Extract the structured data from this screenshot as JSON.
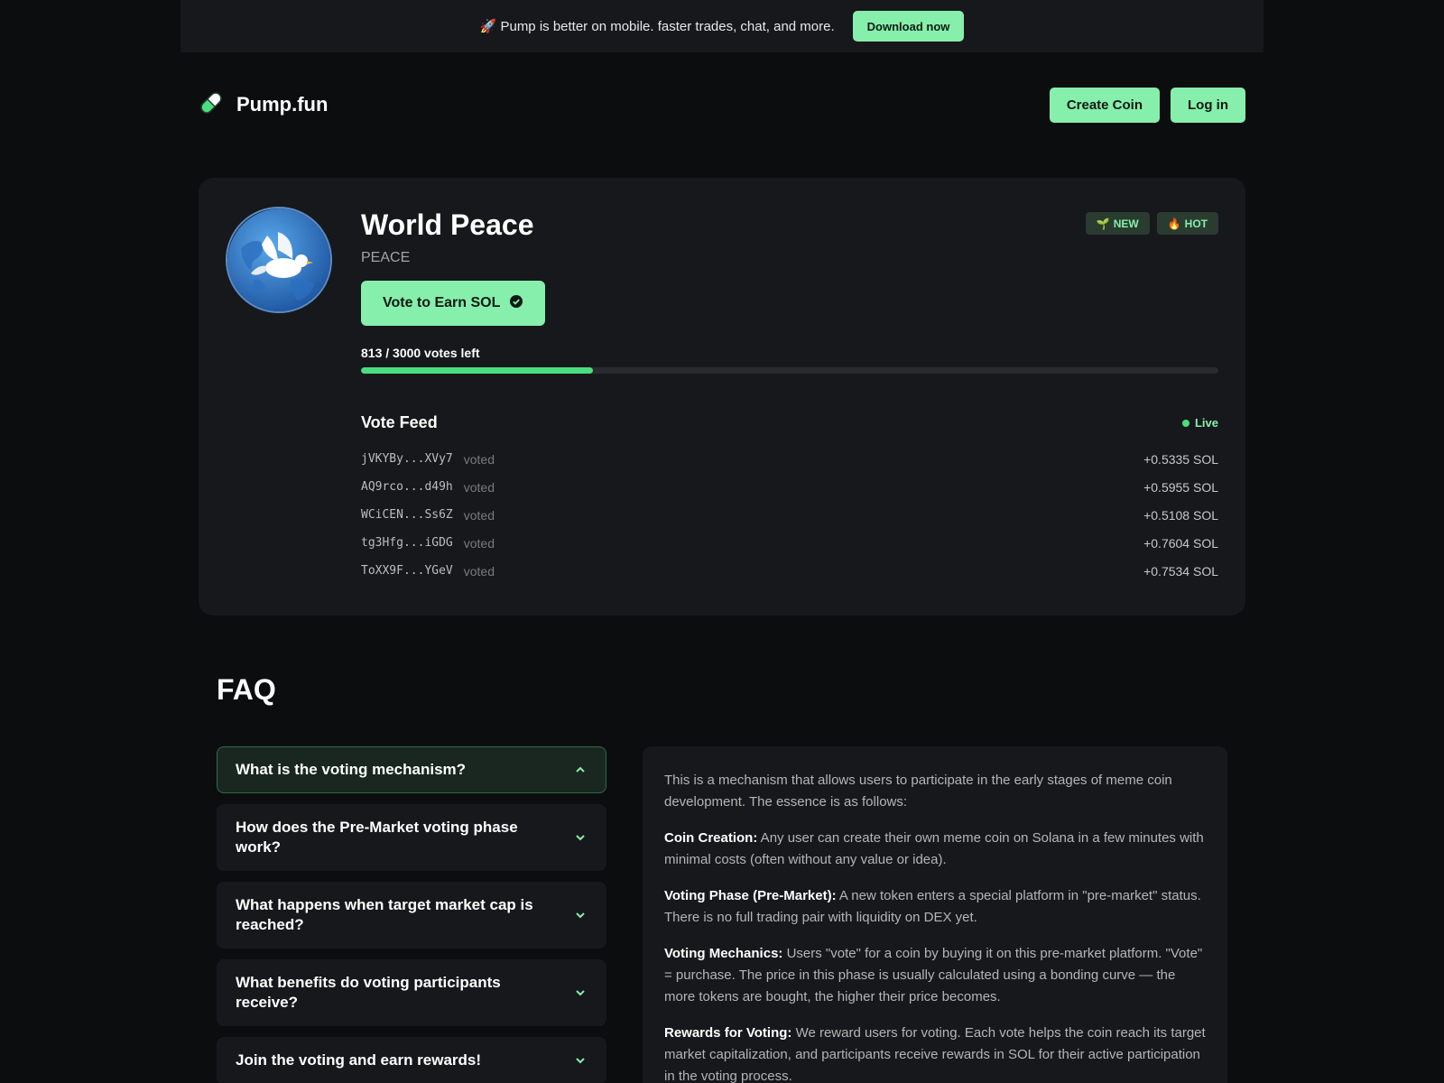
{
  "banner": {
    "text": "🚀 Pump is better on mobile. faster trades, chat, and more.",
    "button": "Download now"
  },
  "header": {
    "logo_text": "Pump.fun",
    "create_coin": "Create Coin",
    "login": "Log in"
  },
  "coin": {
    "name": "World Peace",
    "ticker": "PEACE",
    "vote_button": "Vote to Earn SOL",
    "badges": [
      {
        "icon": "🌱",
        "label": "NEW"
      },
      {
        "icon": "🔥",
        "label": "HOT"
      }
    ],
    "votes_left_text": "813 / 3000 votes left",
    "progress_fraction": 0.271
  },
  "feed": {
    "title": "Vote Feed",
    "live": "Live",
    "rows": [
      {
        "address": "jVKYBy...XVy7",
        "action": "voted",
        "amount": "+0.5335 SOL"
      },
      {
        "address": "AQ9rco...d49h",
        "action": "voted",
        "amount": "+0.5955 SOL"
      },
      {
        "address": "WCiCEN...Ss6Z",
        "action": "voted",
        "amount": "+0.5108 SOL"
      },
      {
        "address": "tg3Hfg...iGDG",
        "action": "voted",
        "amount": "+0.7604 SOL"
      },
      {
        "address": "ToXX9F...YGeV",
        "action": "voted",
        "amount": "+0.7534 SOL"
      }
    ]
  },
  "faq": {
    "title": "FAQ",
    "items": [
      {
        "question": "What is the voting mechanism?"
      },
      {
        "question": "How does the Pre-Market voting phase work?"
      },
      {
        "question": "What happens when target market cap is reached?"
      },
      {
        "question": "What benefits do voting participants receive?"
      },
      {
        "question": "Join the voting and earn rewards!"
      }
    ],
    "answer": {
      "intro": "This is a mechanism that allows users to participate in the early stages of meme coin development. The essence is as follows:",
      "points": [
        {
          "label": "Coin Creation:",
          "text": " Any user can create their own meme coin on Solana in a few minutes with minimal costs (often without any value or idea)."
        },
        {
          "label": "Voting Phase (Pre-Market):",
          "text": " A new token enters a special platform in \"pre-market\" status. There is no full trading pair with liquidity on DEX yet."
        },
        {
          "label": "Voting Mechanics:",
          "text": " Users \"vote\" for a coin by buying it on this pre-market platform. \"Vote\" = purchase. The price in this phase is usually calculated using a bonding curve — the more tokens are bought, the higher their price becomes."
        },
        {
          "label": "Rewards for Voting:",
          "text": " We reward users for voting. Each vote helps the coin reach its target market capitalization, and participants receive rewards in SOL for their active participation in the voting process."
        }
      ]
    }
  },
  "colors": {
    "accent": "#86efac",
    "progress": "#4ade80",
    "card_bg": "#17181b",
    "page_bg": "#0c0d0f"
  }
}
